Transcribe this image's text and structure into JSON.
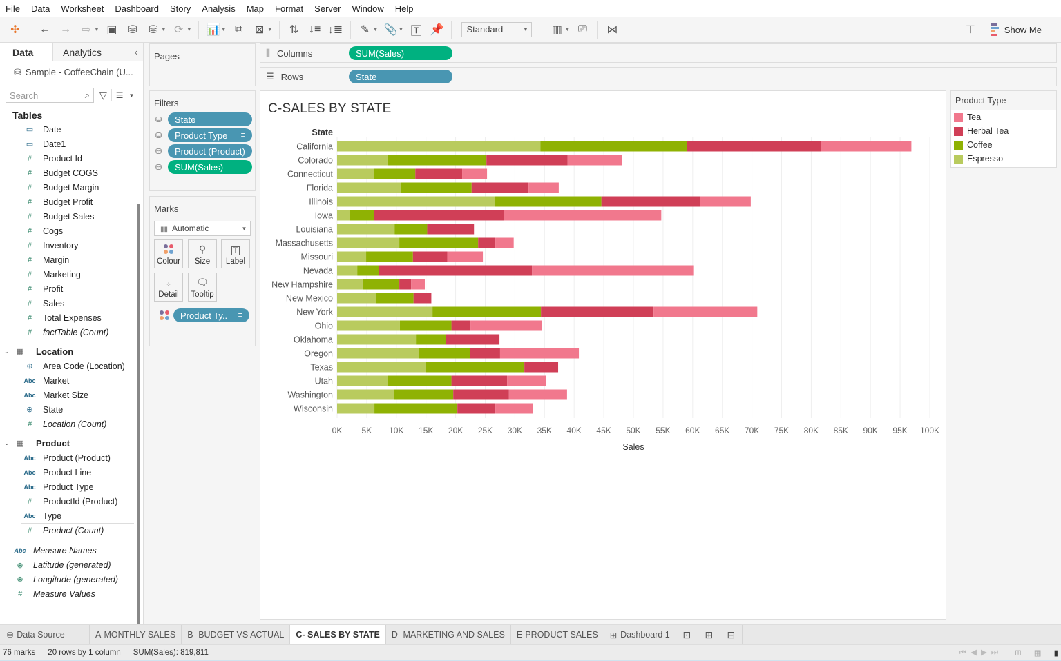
{
  "menu": [
    "File",
    "Data",
    "Worksheet",
    "Dashboard",
    "Story",
    "Analysis",
    "Map",
    "Format",
    "Server",
    "Window",
    "Help"
  ],
  "toolbar": {
    "fit_select": "Standard",
    "show_me_label": "Show Me"
  },
  "data_pane": {
    "tabs": [
      "Data",
      "Analytics"
    ],
    "datasource": "Sample - CoffeeChain (U...",
    "search_placeholder": "Search",
    "tables_heading": "Tables",
    "fields": [
      {
        "name": "Date",
        "type": "date"
      },
      {
        "name": "Date1",
        "type": "date"
      },
      {
        "name": "Product Id",
        "type": "measure"
      },
      {
        "name": "Budget COGS",
        "type": "measure",
        "sep": true
      },
      {
        "name": "Budget Margin",
        "type": "measure"
      },
      {
        "name": "Budget Profit",
        "type": "measure"
      },
      {
        "name": "Budget Sales",
        "type": "measure"
      },
      {
        "name": "Cogs",
        "type": "measure"
      },
      {
        "name": "Inventory",
        "type": "measure"
      },
      {
        "name": "Margin",
        "type": "measure"
      },
      {
        "name": "Marketing",
        "type": "measure"
      },
      {
        "name": "Profit",
        "type": "measure"
      },
      {
        "name": "Sales",
        "type": "measure"
      },
      {
        "name": "Total Expenses",
        "type": "measure"
      },
      {
        "name": "factTable (Count)",
        "type": "measure",
        "italic": true
      }
    ],
    "groups": [
      {
        "name": "Location",
        "fields": [
          {
            "name": "Area Code (Location)",
            "type": "geo"
          },
          {
            "name": "Market",
            "type": "string"
          },
          {
            "name": "Market Size",
            "type": "string"
          },
          {
            "name": "State",
            "type": "geo"
          },
          {
            "name": "Location (Count)",
            "type": "measure",
            "italic": true,
            "sep": true
          }
        ]
      },
      {
        "name": "Product",
        "fields": [
          {
            "name": "Product (Product)",
            "type": "string"
          },
          {
            "name": "Product Line",
            "type": "string"
          },
          {
            "name": "Product Type",
            "type": "string"
          },
          {
            "name": "ProductId (Product)",
            "type": "measure"
          },
          {
            "name": "Type",
            "type": "string"
          },
          {
            "name": "Product (Count)",
            "type": "measure",
            "italic": true,
            "sep": true
          }
        ]
      }
    ],
    "root_fields": [
      {
        "name": "Measure Names",
        "type": "string",
        "italic": true
      },
      {
        "name": "Latitude (generated)",
        "type": "geo",
        "italic": true,
        "sep": true
      },
      {
        "name": "Longitude (generated)",
        "type": "geo",
        "italic": true
      },
      {
        "name": "Measure Values",
        "type": "measure",
        "italic": true
      }
    ]
  },
  "pages": {
    "title": "Pages"
  },
  "filters": {
    "title": "Filters",
    "items": [
      {
        "label": "State",
        "kind": "dim"
      },
      {
        "label": "Product Type",
        "kind": "dim",
        "sorted": true
      },
      {
        "label": "Product (Product)",
        "kind": "dim"
      },
      {
        "label": "SUM(Sales)",
        "kind": "meas"
      }
    ]
  },
  "marks": {
    "title": "Marks",
    "type": "Automatic",
    "buttons": [
      "Colour",
      "Size",
      "Label",
      "Detail",
      "Tooltip"
    ],
    "color_pill": "Product Ty.."
  },
  "shelves": {
    "columns_label": "Columns",
    "columns_pill": "SUM(Sales)",
    "rows_label": "Rows",
    "rows_pill": "State"
  },
  "legend": {
    "title": "Product Type",
    "items": [
      {
        "label": "Tea",
        "color": "#f1788d"
      },
      {
        "label": "Herbal Tea",
        "color": "#d03f57"
      },
      {
        "label": "Coffee",
        "color": "#8fb203"
      },
      {
        "label": "Espresso",
        "color": "#b9cb5e"
      }
    ]
  },
  "chart_data": {
    "type": "bar",
    "orientation": "horizontal",
    "stacked": true,
    "title": "C-SALES BY STATE",
    "row_header": "State",
    "xlabel": "Sales",
    "ylabel": "State",
    "xlim": [
      0,
      100000
    ],
    "x_ticks": [
      "0K",
      "5K",
      "10K",
      "15K",
      "20K",
      "25K",
      "30K",
      "35K",
      "40K",
      "45K",
      "50K",
      "55K",
      "60K",
      "65K",
      "70K",
      "75K",
      "80K",
      "85K",
      "90K",
      "95K",
      "100K"
    ],
    "grid": true,
    "categories": [
      "California",
      "Colorado",
      "Connecticut",
      "Florida",
      "Illinois",
      "Iowa",
      "Louisiana",
      "Massachusetts",
      "Missouri",
      "Nevada",
      "New Hampshire",
      "New Mexico",
      "New York",
      "Ohio",
      "Oklahoma",
      "Oregon",
      "Texas",
      "Utah",
      "Washington",
      "Wisconsin"
    ],
    "series": [
      {
        "name": "Espresso",
        "color": "#b9cb5e",
        "values": [
          34300,
          8500,
          6200,
          10700,
          26600,
          2200,
          9700,
          10500,
          4900,
          3400,
          4300,
          6500,
          16100,
          10600,
          13300,
          13800,
          15000,
          8600,
          9600,
          6300
        ]
      },
      {
        "name": "Coffee",
        "color": "#8fb203",
        "values": [
          24700,
          16700,
          7000,
          12000,
          18000,
          4000,
          5500,
          13300,
          7900,
          3700,
          6200,
          6400,
          18300,
          8700,
          5000,
          8600,
          16600,
          10700,
          10000,
          14000
        ]
      },
      {
        "name": "Herbal Tea",
        "color": "#d03f57",
        "values": [
          22700,
          13700,
          7900,
          9600,
          16600,
          22000,
          7900,
          2900,
          5800,
          25800,
          2000,
          3000,
          19000,
          3200,
          9100,
          5100,
          5700,
          9400,
          9400,
          6400
        ]
      },
      {
        "name": "Tea",
        "color": "#f1788d",
        "values": [
          15200,
          9200,
          4200,
          5100,
          8600,
          26500,
          0,
          3100,
          6000,
          27200,
          2300,
          0,
          17500,
          12000,
          0,
          13300,
          0,
          6600,
          9800,
          6300
        ]
      }
    ],
    "legend_position": "right"
  },
  "sheet_tabs": [
    {
      "label": "Data Source",
      "icon": "database-icon"
    },
    {
      "label": "A-MONTHLY SALES"
    },
    {
      "label": "B- BUDGET VS ACTUAL"
    },
    {
      "label": "C- SALES BY STATE",
      "active": true
    },
    {
      "label": "D- MARKETING AND SALES"
    },
    {
      "label": "E-PRODUCT SALES"
    },
    {
      "label": "Dashboard 1",
      "icon": "dashboard-icon"
    }
  ],
  "status": {
    "marks": "76 marks",
    "rows_cols": "20 rows by 1 column",
    "sum": "SUM(Sales): 819,811"
  }
}
